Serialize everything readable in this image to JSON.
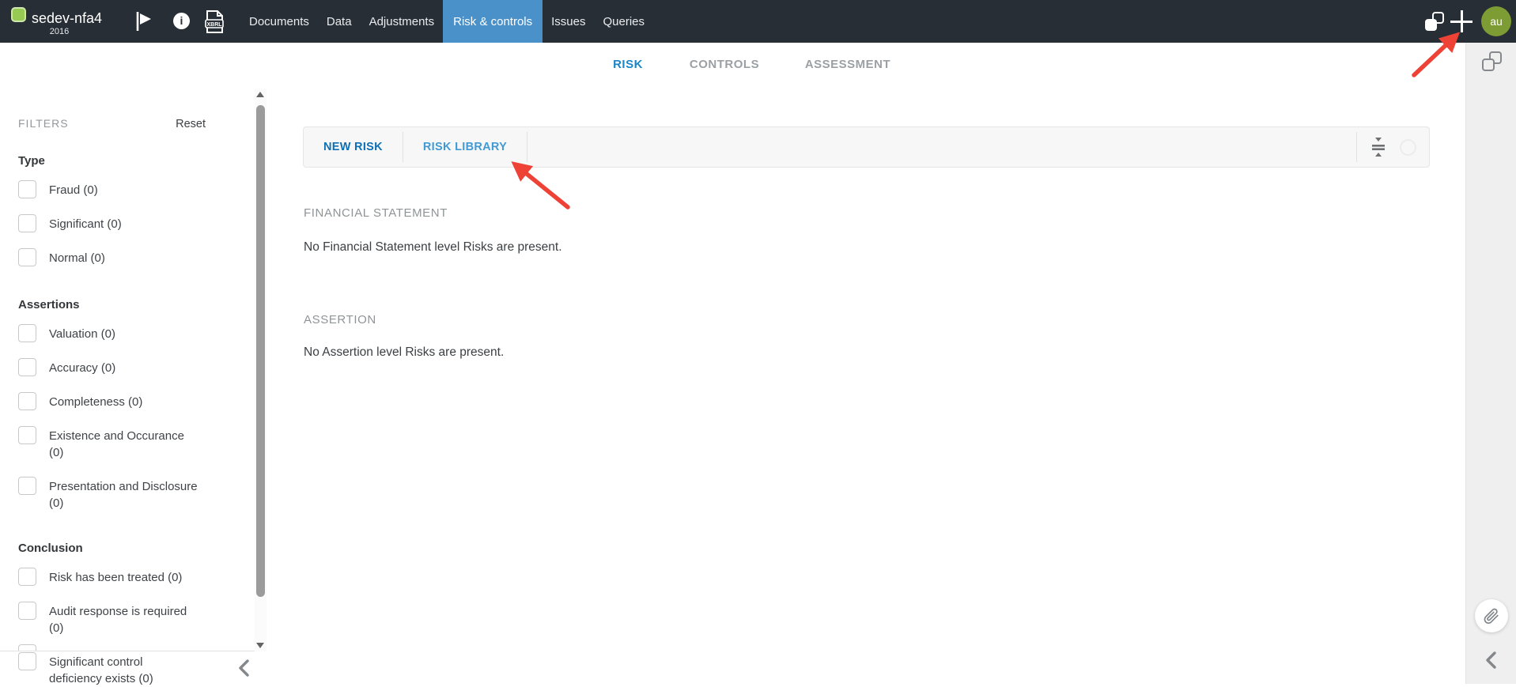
{
  "topbar": {
    "product": "sedev-nfa4",
    "year": "2016",
    "xbrl_label": "XBRL",
    "nav": [
      {
        "label": "Documents",
        "active": false
      },
      {
        "label": "Data",
        "active": false
      },
      {
        "label": "Adjustments",
        "active": false
      },
      {
        "label": "Risk & controls",
        "active": true
      },
      {
        "label": "Issues",
        "active": false
      },
      {
        "label": "Queries",
        "active": false
      }
    ],
    "avatar_initials": "au"
  },
  "tabs": [
    {
      "label": "RISK",
      "active": true
    },
    {
      "label": "CONTROLS",
      "active": false
    },
    {
      "label": "ASSESSMENT",
      "active": false
    }
  ],
  "filters": {
    "title": "FILTERS",
    "reset_label": "Reset",
    "groups": [
      {
        "title": "Type",
        "items": [
          {
            "label": "Fraud (0)",
            "checked": false
          },
          {
            "label": "Significant (0)",
            "checked": false
          },
          {
            "label": "Normal (0)",
            "checked": false
          }
        ]
      },
      {
        "title": "Assertions",
        "items": [
          {
            "label": "Valuation (0)",
            "checked": false
          },
          {
            "label": "Accuracy (0)",
            "checked": false
          },
          {
            "label": "Completeness (0)",
            "checked": false
          },
          {
            "label": "Existence and Occurance (0)",
            "checked": false
          },
          {
            "label": "Presentation and Disclosure (0)",
            "checked": false
          }
        ]
      },
      {
        "title": "Conclusion",
        "items": [
          {
            "label": "Risk has been treated (0)",
            "checked": false
          },
          {
            "label": "Audit response is required (0)",
            "checked": false
          },
          {
            "label": "Significant control deficiency exists (0)",
            "checked": false
          }
        ]
      }
    ]
  },
  "toolbar": {
    "new_risk_label": "NEW RISK",
    "risk_library_label": "RISK LIBRARY"
  },
  "sections": {
    "financial_statement_title": "FINANCIAL STATEMENT",
    "financial_statement_empty": "No Financial Statement level Risks are present.",
    "assertion_title": "ASSERTION",
    "assertion_empty": "No Assertion level Risks are present."
  },
  "colors": {
    "topbar_bg": "#272e36",
    "active_nav_blue": "#4a90c9",
    "tab_blue": "#1a86c8",
    "new_risk_blue": "#0f6fb3",
    "risk_library_blue": "#419ad4",
    "annotation_red": "#ee4237",
    "avatar_green": "#7d9c33",
    "logo_green": "#97ca53"
  }
}
